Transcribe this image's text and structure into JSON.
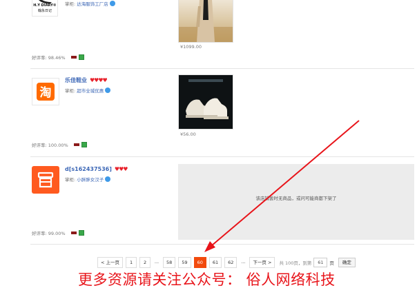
{
  "shops": [
    {
      "logo_text": "H.Y DIARY®",
      "logo_sub": "翰永日记",
      "owner_prefix": "掌柜:",
      "owner_nick": "达海服饰工厂店",
      "rate_label": "好评率: 98.46%",
      "product_price": "¥1099.00"
    },
    {
      "name": "乐佳鞋业",
      "hearts": "♥♥♥♥",
      "logo_text": "淘",
      "owner_prefix": "掌柜:",
      "owner_nick": "超市全城优惠",
      "rate_label": "好评率: 100.00%",
      "product_price": "¥56.00"
    },
    {
      "name": "d[s162437536]",
      "hearts": "♥♥♥",
      "owner_prefix": "掌柜:",
      "owner_nick": "小胖胖女汉子",
      "rate_label": "好评率: 99.00%",
      "empty_message": "该店铺暂时无商品，或问可能商都下架了"
    }
  ],
  "pager": {
    "prev": "< 上一页",
    "pages": [
      "1",
      "2",
      "...",
      "58",
      "59",
      "60",
      "61",
      "62",
      "..."
    ],
    "current": "60",
    "next": "下一页 >",
    "total": "共 100页，到第",
    "jump_value": "61",
    "page_unit": "页",
    "confirm": "确定"
  },
  "watermark": "更多资源请关注公众号： 俗人网络科技",
  "colors": {
    "accent": "#f24a0d",
    "link": "#3c67b6",
    "annotation": "#e8141a"
  }
}
